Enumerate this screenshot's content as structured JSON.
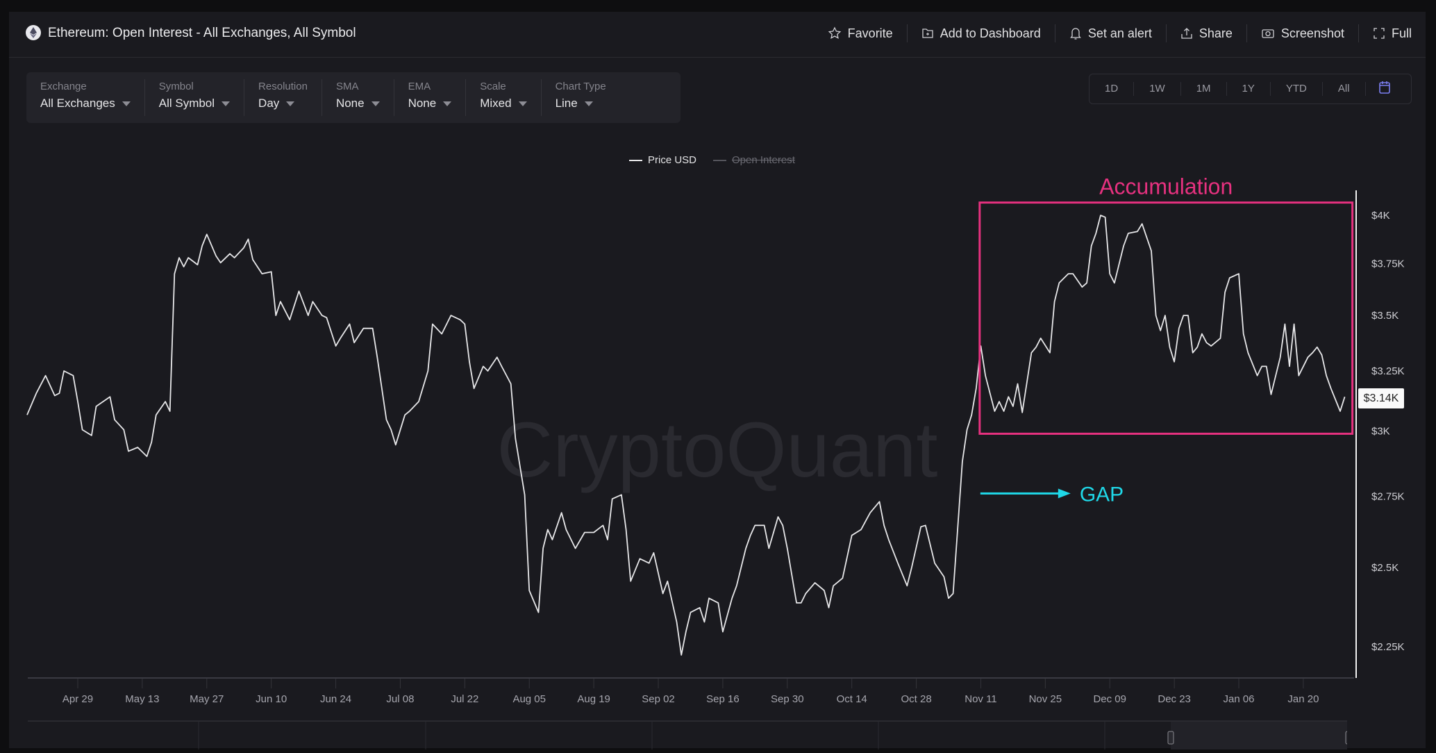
{
  "header": {
    "title": "Ethereum: Open Interest - All Exchanges, All Symbol",
    "actions": [
      {
        "label": "Favorite",
        "icon": "star-icon"
      },
      {
        "label": "Add to Dashboard",
        "icon": "folder-plus-icon"
      },
      {
        "label": "Set an alert",
        "icon": "bell-icon"
      },
      {
        "label": "Share",
        "icon": "share-icon"
      },
      {
        "label": "Screenshot",
        "icon": "camera-icon"
      },
      {
        "label": "Full",
        "icon": "fullscreen-icon"
      }
    ]
  },
  "filters": [
    {
      "label": "Exchange",
      "value": "All Exchanges"
    },
    {
      "label": "Symbol",
      "value": "All Symbol"
    },
    {
      "label": "Resolution",
      "value": "Day"
    },
    {
      "label": "SMA",
      "value": "None"
    },
    {
      "label": "EMA",
      "value": "None"
    },
    {
      "label": "Scale",
      "value": "Mixed"
    },
    {
      "label": "Chart Type",
      "value": "Line"
    }
  ],
  "ranges": [
    "1D",
    "1W",
    "1M",
    "1Y",
    "YTD",
    "All"
  ],
  "colors": {
    "accent": "#7b7ef0",
    "annotation_box": "#e6317f",
    "gap_arrow": "#1fd8e8",
    "line": "#e8e8ea"
  },
  "watermark": "CryptoQuant",
  "chart_data": {
    "type": "line",
    "legend": [
      {
        "name": "Price USD",
        "visible": true
      },
      {
        "name": "Open Interest",
        "visible": false
      }
    ],
    "legend_position": "top-center",
    "y_scale": "log",
    "ylim": [
      2225,
      4050
    ],
    "y_ticks": [
      {
        "value": 4000,
        "label": "$4K"
      },
      {
        "value": 3750,
        "label": "$3.75K"
      },
      {
        "value": 3500,
        "label": "$3.5K"
      },
      {
        "value": 3250,
        "label": "$3.25K"
      },
      {
        "value": 3000,
        "label": "$3K"
      },
      {
        "value": 2750,
        "label": "$2.75K"
      },
      {
        "value": 2500,
        "label": "$2.5K"
      },
      {
        "value": 2250,
        "label": "$2.25K"
      }
    ],
    "x_ticks": [
      {
        "date": "2024-04-29",
        "label": "Apr 29"
      },
      {
        "date": "2024-05-13",
        "label": "May 13"
      },
      {
        "date": "2024-05-27",
        "label": "May 27"
      },
      {
        "date": "2024-06-10",
        "label": "Jun 10"
      },
      {
        "date": "2024-06-24",
        "label": "Jun 24"
      },
      {
        "date": "2024-07-08",
        "label": "Jul 08"
      },
      {
        "date": "2024-07-22",
        "label": "Jul 22"
      },
      {
        "date": "2024-08-05",
        "label": "Aug 05"
      },
      {
        "date": "2024-08-19",
        "label": "Aug 19"
      },
      {
        "date": "2024-09-02",
        "label": "Sep 02"
      },
      {
        "date": "2024-09-16",
        "label": "Sep 16"
      },
      {
        "date": "2024-09-30",
        "label": "Sep 30"
      },
      {
        "date": "2024-10-14",
        "label": "Oct 14"
      },
      {
        "date": "2024-10-28",
        "label": "Oct 28"
      },
      {
        "date": "2024-11-11",
        "label": "Nov 11"
      },
      {
        "date": "2024-11-25",
        "label": "Nov 25"
      },
      {
        "date": "2024-12-09",
        "label": "Dec 09"
      },
      {
        "date": "2024-12-23",
        "label": "Dec 23"
      },
      {
        "date": "2025-01-06",
        "label": "Jan 06"
      },
      {
        "date": "2025-01-20",
        "label": "Jan 20"
      }
    ],
    "last_value_label": "$3.14K",
    "grid": false,
    "annotations": [
      {
        "type": "box",
        "text": "Accumulation",
        "x_range": [
          "2024-11-10",
          "2025-01-29"
        ],
        "y_range": [
          3000,
          4050
        ]
      },
      {
        "type": "arrow",
        "text": "GAP",
        "at_date": "2024-11-10",
        "value": 2760
      }
    ],
    "series": [
      {
        "name": "Price USD",
        "points": [
          [
            "2024-04-18",
            3065
          ],
          [
            "2024-04-20",
            3155
          ],
          [
            "2024-04-22",
            3230
          ],
          [
            "2024-04-24",
            3145
          ],
          [
            "2024-04-25",
            3155
          ],
          [
            "2024-04-26",
            3250
          ],
          [
            "2024-04-28",
            3230
          ],
          [
            "2024-04-29",
            3120
          ],
          [
            "2024-04-30",
            3005
          ],
          [
            "2024-05-02",
            2982
          ],
          [
            "2024-05-03",
            3100
          ],
          [
            "2024-05-06",
            3140
          ],
          [
            "2024-05-07",
            3045
          ],
          [
            "2024-05-09",
            3005
          ],
          [
            "2024-05-10",
            2920
          ],
          [
            "2024-05-12",
            2935
          ],
          [
            "2024-05-14",
            2900
          ],
          [
            "2024-05-15",
            2955
          ],
          [
            "2024-05-16",
            3065
          ],
          [
            "2024-05-18",
            3120
          ],
          [
            "2024-05-19",
            3080
          ],
          [
            "2024-05-20",
            3700
          ],
          [
            "2024-05-21",
            3780
          ],
          [
            "2024-05-22",
            3735
          ],
          [
            "2024-05-23",
            3780
          ],
          [
            "2024-05-25",
            3745
          ],
          [
            "2024-05-26",
            3840
          ],
          [
            "2024-05-27",
            3900
          ],
          [
            "2024-05-29",
            3790
          ],
          [
            "2024-05-30",
            3755
          ],
          [
            "2024-06-01",
            3800
          ],
          [
            "2024-06-02",
            3780
          ],
          [
            "2024-06-04",
            3830
          ],
          [
            "2024-06-05",
            3875
          ],
          [
            "2024-06-06",
            3770
          ],
          [
            "2024-06-08",
            3700
          ],
          [
            "2024-06-10",
            3710
          ],
          [
            "2024-06-11",
            3500
          ],
          [
            "2024-06-12",
            3565
          ],
          [
            "2024-06-14",
            3480
          ],
          [
            "2024-06-16",
            3615
          ],
          [
            "2024-06-18",
            3500
          ],
          [
            "2024-06-19",
            3565
          ],
          [
            "2024-06-21",
            3500
          ],
          [
            "2024-06-22",
            3490
          ],
          [
            "2024-06-24",
            3360
          ],
          [
            "2024-06-25",
            3395
          ],
          [
            "2024-06-27",
            3460
          ],
          [
            "2024-06-28",
            3375
          ],
          [
            "2024-06-30",
            3440
          ],
          [
            "2024-07-02",
            3440
          ],
          [
            "2024-07-03",
            3310
          ],
          [
            "2024-07-05",
            3045
          ],
          [
            "2024-07-06",
            3005
          ],
          [
            "2024-07-07",
            2945
          ],
          [
            "2024-07-09",
            3065
          ],
          [
            "2024-07-10",
            3080
          ],
          [
            "2024-07-12",
            3120
          ],
          [
            "2024-07-14",
            3250
          ],
          [
            "2024-07-15",
            3460
          ],
          [
            "2024-07-17",
            3415
          ],
          [
            "2024-07-19",
            3500
          ],
          [
            "2024-07-21",
            3480
          ],
          [
            "2024-07-22",
            3460
          ],
          [
            "2024-07-23",
            3290
          ],
          [
            "2024-07-24",
            3175
          ],
          [
            "2024-07-26",
            3270
          ],
          [
            "2024-07-27",
            3250
          ],
          [
            "2024-07-29",
            3310
          ],
          [
            "2024-07-30",
            3270
          ],
          [
            "2024-08-01",
            3195
          ],
          [
            "2024-08-02",
            2970
          ],
          [
            "2024-08-04",
            2755
          ],
          [
            "2024-08-05",
            2425
          ],
          [
            "2024-08-07",
            2355
          ],
          [
            "2024-08-08",
            2565
          ],
          [
            "2024-08-09",
            2630
          ],
          [
            "2024-08-10",
            2595
          ],
          [
            "2024-08-12",
            2690
          ],
          [
            "2024-08-13",
            2630
          ],
          [
            "2024-08-15",
            2565
          ],
          [
            "2024-08-17",
            2620
          ],
          [
            "2024-08-19",
            2620
          ],
          [
            "2024-08-21",
            2645
          ],
          [
            "2024-08-22",
            2595
          ],
          [
            "2024-08-23",
            2740
          ],
          [
            "2024-08-25",
            2755
          ],
          [
            "2024-08-26",
            2630
          ],
          [
            "2024-08-27",
            2455
          ],
          [
            "2024-08-29",
            2530
          ],
          [
            "2024-08-31",
            2515
          ],
          [
            "2024-09-01",
            2550
          ],
          [
            "2024-09-03",
            2415
          ],
          [
            "2024-09-04",
            2455
          ],
          [
            "2024-09-06",
            2325
          ],
          [
            "2024-09-07",
            2225
          ],
          [
            "2024-09-08",
            2295
          ],
          [
            "2024-09-09",
            2355
          ],
          [
            "2024-09-11",
            2370
          ],
          [
            "2024-09-12",
            2325
          ],
          [
            "2024-09-13",
            2400
          ],
          [
            "2024-09-15",
            2385
          ],
          [
            "2024-09-16",
            2295
          ],
          [
            "2024-09-18",
            2400
          ],
          [
            "2024-09-19",
            2440
          ],
          [
            "2024-09-21",
            2565
          ],
          [
            "2024-09-22",
            2610
          ],
          [
            "2024-09-23",
            2645
          ],
          [
            "2024-09-25",
            2645
          ],
          [
            "2024-09-26",
            2565
          ],
          [
            "2024-09-28",
            2675
          ],
          [
            "2024-09-29",
            2645
          ],
          [
            "2024-09-30",
            2565
          ],
          [
            "2024-10-02",
            2385
          ],
          [
            "2024-10-03",
            2385
          ],
          [
            "2024-10-04",
            2415
          ],
          [
            "2024-10-06",
            2450
          ],
          [
            "2024-10-08",
            2425
          ],
          [
            "2024-10-09",
            2370
          ],
          [
            "2024-10-10",
            2440
          ],
          [
            "2024-10-12",
            2465
          ],
          [
            "2024-10-14",
            2610
          ],
          [
            "2024-10-16",
            2630
          ],
          [
            "2024-10-17",
            2660
          ],
          [
            "2024-10-18",
            2690
          ],
          [
            "2024-10-20",
            2730
          ],
          [
            "2024-10-21",
            2645
          ],
          [
            "2024-10-22",
            2595
          ],
          [
            "2024-10-24",
            2515
          ],
          [
            "2024-10-26",
            2440
          ],
          [
            "2024-10-27",
            2500
          ],
          [
            "2024-10-29",
            2640
          ],
          [
            "2024-10-30",
            2645
          ],
          [
            "2024-11-01",
            2515
          ],
          [
            "2024-11-03",
            2470
          ],
          [
            "2024-11-04",
            2400
          ],
          [
            "2024-11-05",
            2415
          ],
          [
            "2024-11-07",
            2880
          ],
          [
            "2024-11-08",
            3005
          ],
          [
            "2024-11-09",
            3065
          ],
          [
            "2024-11-10",
            3175
          ],
          [
            "2024-11-11",
            3360
          ],
          [
            "2024-11-12",
            3230
          ],
          [
            "2024-11-14",
            3080
          ],
          [
            "2024-11-15",
            3120
          ],
          [
            "2024-11-16",
            3080
          ],
          [
            "2024-11-17",
            3140
          ],
          [
            "2024-11-18",
            3100
          ],
          [
            "2024-11-19",
            3195
          ],
          [
            "2024-11-20",
            3075
          ],
          [
            "2024-11-22",
            3330
          ],
          [
            "2024-11-23",
            3355
          ],
          [
            "2024-11-24",
            3395
          ],
          [
            "2024-11-26",
            3330
          ],
          [
            "2024-11-27",
            3565
          ],
          [
            "2024-11-28",
            3655
          ],
          [
            "2024-11-30",
            3700
          ],
          [
            "2024-12-01",
            3700
          ],
          [
            "2024-12-03",
            3635
          ],
          [
            "2024-12-04",
            3655
          ],
          [
            "2024-12-05",
            3840
          ],
          [
            "2024-12-06",
            3905
          ],
          [
            "2024-12-07",
            4000
          ],
          [
            "2024-12-08",
            3990
          ],
          [
            "2024-12-09",
            3700
          ],
          [
            "2024-12-10",
            3655
          ],
          [
            "2024-12-12",
            3840
          ],
          [
            "2024-12-13",
            3905
          ],
          [
            "2024-12-15",
            3915
          ],
          [
            "2024-12-16",
            3955
          ],
          [
            "2024-12-18",
            3815
          ],
          [
            "2024-12-19",
            3500
          ],
          [
            "2024-12-20",
            3430
          ],
          [
            "2024-12-21",
            3500
          ],
          [
            "2024-12-22",
            3355
          ],
          [
            "2024-12-23",
            3290
          ],
          [
            "2024-12-24",
            3440
          ],
          [
            "2024-12-25",
            3500
          ],
          [
            "2024-12-26",
            3500
          ],
          [
            "2024-12-27",
            3330
          ],
          [
            "2024-12-28",
            3355
          ],
          [
            "2024-12-29",
            3415
          ],
          [
            "2024-12-30",
            3375
          ],
          [
            "2024-12-31",
            3360
          ],
          [
            "2025-01-02",
            3395
          ],
          [
            "2025-01-03",
            3610
          ],
          [
            "2025-01-04",
            3680
          ],
          [
            "2025-01-06",
            3700
          ],
          [
            "2025-01-07",
            3415
          ],
          [
            "2025-01-08",
            3330
          ],
          [
            "2025-01-10",
            3230
          ],
          [
            "2025-01-11",
            3270
          ],
          [
            "2025-01-12",
            3270
          ],
          [
            "2025-01-13",
            3150
          ],
          [
            "2025-01-15",
            3310
          ],
          [
            "2025-01-16",
            3460
          ],
          [
            "2025-01-17",
            3270
          ],
          [
            "2025-01-18",
            3460
          ],
          [
            "2025-01-19",
            3230
          ],
          [
            "2025-01-21",
            3310
          ],
          [
            "2025-01-22",
            3330
          ],
          [
            "2025-01-23",
            3355
          ],
          [
            "2025-01-24",
            3320
          ],
          [
            "2025-01-25",
            3230
          ],
          [
            "2025-01-26",
            3175
          ],
          [
            "2025-01-28",
            3080
          ],
          [
            "2025-01-29",
            3140
          ]
        ]
      }
    ]
  }
}
